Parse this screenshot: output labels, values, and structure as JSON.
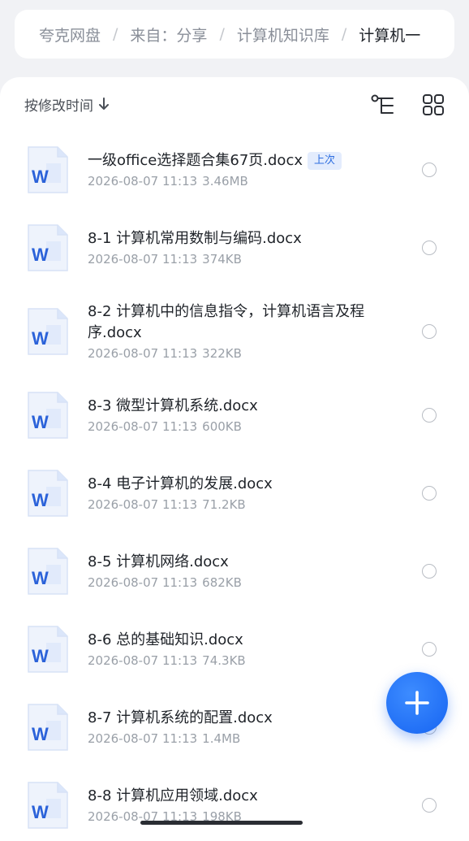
{
  "breadcrumb": {
    "items": [
      "夸克网盘",
      "来自：分享",
      "计算机知识库",
      "计算机一"
    ],
    "separator": "/"
  },
  "toolbar": {
    "sort_label": "按修改时间",
    "sort_icon": "arrow-down-icon",
    "tree_icon": "tree-view-icon",
    "grid_icon": "grid-view-icon"
  },
  "files": [
    {
      "name": "一级office选择题合集67页.docx",
      "badge": "上次",
      "date": "2026-08-07 11:13",
      "size": "3.46MB"
    },
    {
      "name": "8-1 计算机常用数制与编码.docx",
      "date": "2026-08-07 11:13",
      "size": "374KB"
    },
    {
      "name": "8-2 计算机中的信息指令，计算机语言及程序.docx",
      "date": "2026-08-07 11:13",
      "size": "322KB"
    },
    {
      "name": "8-3 微型计算机系统.docx",
      "date": "2026-08-07 11:13",
      "size": "600KB"
    },
    {
      "name": "8-4 电子计算机的发展.docx",
      "date": "2026-08-07 11:13",
      "size": "71.2KB"
    },
    {
      "name": "8-5 计算机网络.docx",
      "date": "2026-08-07 11:13",
      "size": "682KB"
    },
    {
      "name": "8-6 总的基础知识.docx",
      "date": "2026-08-07 11:13",
      "size": "74.3KB"
    },
    {
      "name": "8-7 计算机系统的配置.docx",
      "date": "2026-08-07 11:13",
      "size": "1.4MB"
    },
    {
      "name": "8-8 计算机应用领域.docx",
      "date": "2026-08-07 11:13",
      "size": "198KB"
    }
  ],
  "file_icon": {
    "letter": "W",
    "name": "word-document-icon",
    "color": "#2b62d9"
  },
  "fab": {
    "icon": "plus-icon",
    "color": "#1f6ff5"
  }
}
